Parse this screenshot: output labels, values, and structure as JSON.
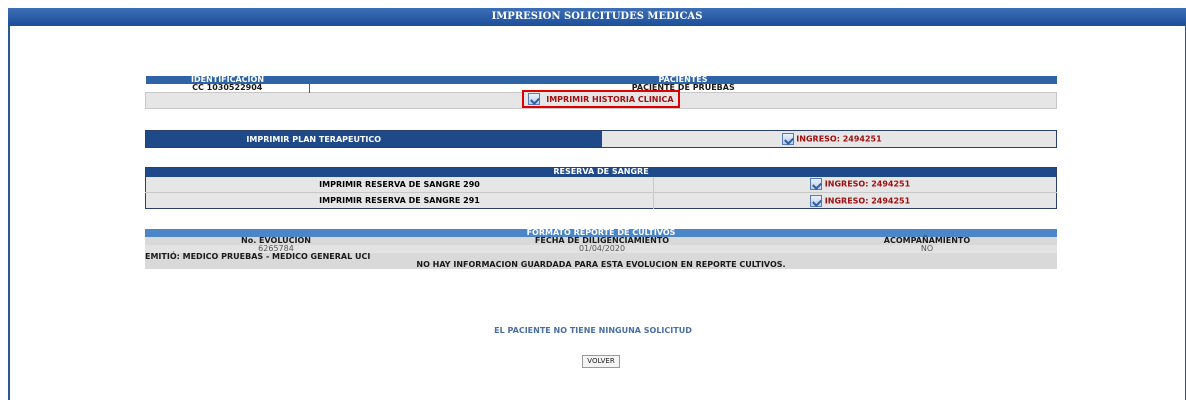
{
  "page": {
    "title": "IMPRESION SOLICITUDES MEDICAS"
  },
  "patient_table": {
    "headers": [
      "IDENTIFICACION",
      "PACIENTES"
    ],
    "identification": "CC 1030522904",
    "patient_name": "PACIENTE DE PRUEBAS",
    "print_history_label": "IMPRIMIR HISTORIA CLINICA"
  },
  "plan": {
    "label": "IMPRIMIR PLAN TERAPEUTICO",
    "ingreso": "INGRESO: 2494251"
  },
  "blood_reserve": {
    "header": "RESERVA DE SANGRE",
    "rows": [
      {
        "label": "IMPRIMIR RESERVA DE SANGRE 290",
        "ingreso": "INGRESO: 2494251"
      },
      {
        "label": "IMPRIMIR RESERVA DE SANGRE 291",
        "ingreso": "INGRESO: 2494251"
      }
    ]
  },
  "cultures": {
    "header": "FORMATO REPORTE DE CULTIVOS",
    "columns": [
      "No. EVOLUCION",
      "FECHA DE DILIGENCIAMIENTO",
      "ACOMPAÑAMIENTO"
    ],
    "row": [
      "6265784",
      "01/04/2020",
      "NO"
    ],
    "emitted_by": "EMITIÓ: MEDICO PRUEBAS - MEDICO GENERAL UCI",
    "no_info": "NO HAY INFORMACION GUARDADA PARA ESTA EVOLUCION EN REPORTE CULTIVOS."
  },
  "no_request_message": "EL PACIENTE NO TIENE NINGUNA SOLICITUD",
  "back_button": "VOLVER",
  "colors": {
    "header_blue": "#2e63a8",
    "link_red": "#a01010",
    "highlight": "#e00000"
  }
}
